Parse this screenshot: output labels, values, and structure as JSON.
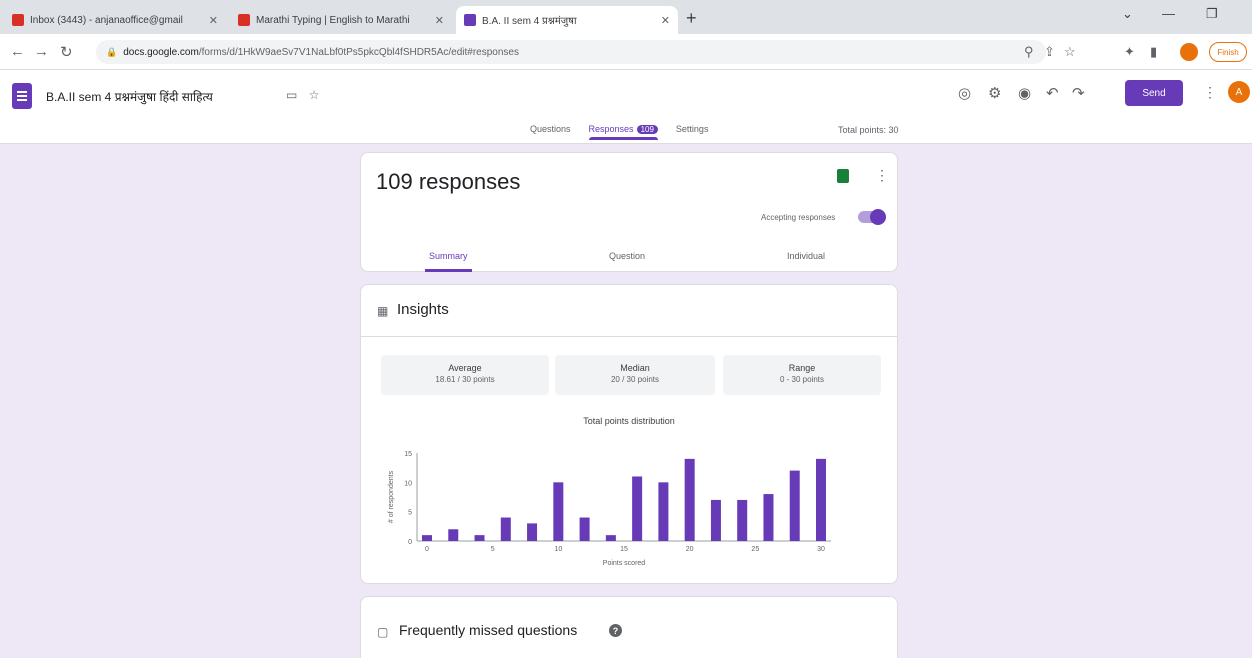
{
  "browser": {
    "tabs": [
      {
        "label": "Inbox (3443) - anjanaoffice@gmail",
        "favicon_color": "#d93025",
        "active": false
      },
      {
        "label": "Marathi Typing | English to Marathi",
        "favicon_color": "#d93025",
        "active": false
      },
      {
        "label": "B.A. II sem 4 प्रश्नमंजुषा",
        "favicon_color": "#673ab7",
        "active": true
      }
    ],
    "new_tab": "+",
    "url_domain": "docs.google.com",
    "url_path": "/forms/d/1HkW9aeSv7V1NaLbf0tPs5pkcQbl4fSHDR5Ac/edit#responses",
    "pill_label": "Finish"
  },
  "forms": {
    "title": "B.A.II sem 4 प्रश्नमंजुषा हिंदी साहित्य",
    "send_label": "Send",
    "avatar_letter": "A",
    "tabs": [
      {
        "label": "Questions"
      },
      {
        "label": "Responses",
        "badge": "109"
      },
      {
        "label": "Settings"
      }
    ],
    "total_points": "Total points: 30"
  },
  "responses": {
    "count_text": "109 responses",
    "accepting_label": "Accepting responses",
    "accepting": true,
    "subtabs": [
      "Summary",
      "Question",
      "Individual"
    ]
  },
  "insights": {
    "title": "Insights",
    "stats": [
      {
        "label": "Average",
        "value": "18.61 / 30 points"
      },
      {
        "label": "Median",
        "value": "20 / 30 points"
      },
      {
        "label": "Range",
        "value": "0 - 30 points"
      }
    ]
  },
  "chart_data": {
    "type": "bar",
    "title": "Total points distribution",
    "xlabel": "Points scored",
    "ylabel": "# of respondents",
    "bar_color": "#673ab7",
    "x": [
      0,
      2,
      4,
      6,
      8,
      10,
      12,
      14,
      16,
      18,
      20,
      22,
      24,
      26,
      28,
      30
    ],
    "values": [
      1,
      2,
      1,
      4,
      3,
      10,
      4,
      1,
      11,
      10,
      14,
      7,
      7,
      8,
      12,
      14
    ],
    "x_ticks": [
      "0",
      "5",
      "10",
      "15",
      "20",
      "25",
      "30"
    ],
    "y_ticks": [
      "0",
      "5",
      "10",
      "15"
    ],
    "ylim": [
      0,
      15
    ],
    "grid": false
  },
  "missed": {
    "title": "Frequently missed questions"
  }
}
